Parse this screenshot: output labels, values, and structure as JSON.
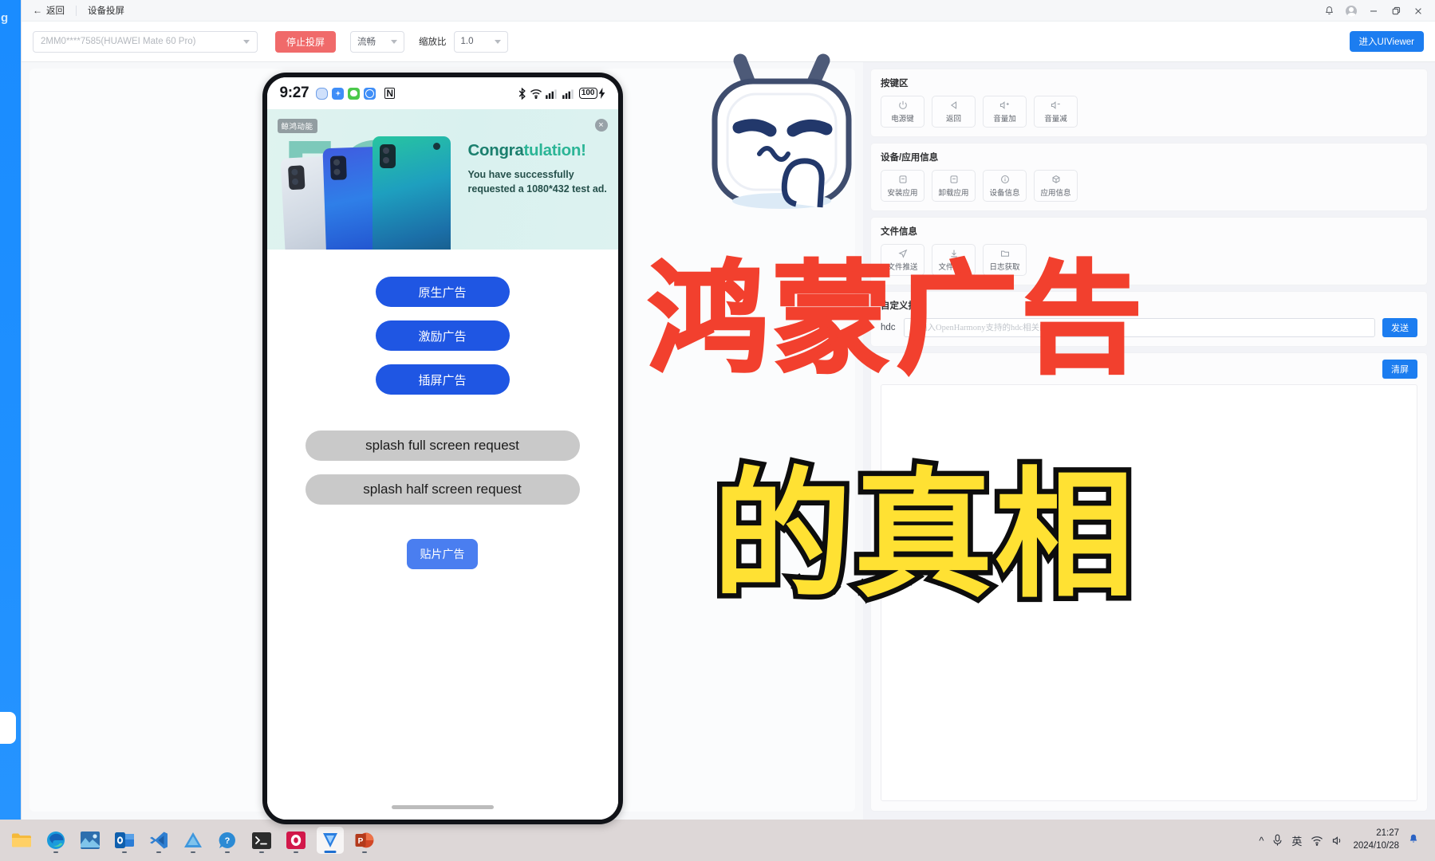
{
  "background_window": {
    "label": "g"
  },
  "titlebar": {
    "back_label": "返回",
    "page_title": "设备投屏",
    "icons": {
      "bell": "bell-icon",
      "avatar": "avatar-icon",
      "minimize": "minimize-icon",
      "restore": "restore-icon",
      "close": "close-icon"
    }
  },
  "toolbar": {
    "device_value": "2MM0****7585(HUAWEI Mate 60 Pro)",
    "stop_label": "停止投屏",
    "quality_value": "流畅",
    "zoom_label": "缩放比",
    "zoom_value": "1.0",
    "uiviewer_label": "进入UIViewer"
  },
  "phone": {
    "status_bar": {
      "time": "9:27",
      "nfc": "N",
      "battery": "100",
      "icons": [
        "app-blue-rounded-icon",
        "app-blue-star-icon",
        "app-wechat-icon",
        "app-compass-icon",
        "nfc-icon",
        "bluetooth-icon",
        "wifi-icon",
        "signal-1-icon",
        "signal-2-icon",
        "battery-icon",
        "charging-icon"
      ]
    },
    "ad": {
      "badge": "鲸鸿动能",
      "close": "×",
      "hero_text": "5G",
      "title_part1": "Congra",
      "title_part2": "tulation!",
      "description": "You have successfully requested a 1080*432 test ad."
    },
    "buttons": [
      {
        "label": "原生广告",
        "style": "blue-pill"
      },
      {
        "label": "激励广告",
        "style": "blue-pill"
      },
      {
        "label": "插屏广告",
        "style": "blue-pill"
      },
      {
        "label": "splash full screen request",
        "style": "grey-pill"
      },
      {
        "label": "splash half screen request",
        "style": "grey-pill"
      },
      {
        "label": "贴片广告",
        "style": "small-blue"
      }
    ]
  },
  "control_panel": {
    "sections": [
      {
        "title": "按键区",
        "buttons": [
          {
            "label": "电源键",
            "icon": "power-icon"
          },
          {
            "label": "返回",
            "icon": "back-triangle-icon"
          },
          {
            "label": "音量加",
            "icon": "volume-up-icon"
          },
          {
            "label": "音量减",
            "icon": "volume-down-icon"
          }
        ]
      },
      {
        "title": "设备/应用信息",
        "buttons": [
          {
            "label": "安装应用",
            "icon": "install-icon"
          },
          {
            "label": "卸载应用",
            "icon": "uninstall-icon"
          },
          {
            "label": "设备信息",
            "icon": "info-circle-icon"
          },
          {
            "label": "应用信息",
            "icon": "cube-icon"
          }
        ]
      },
      {
        "title": "文件信息",
        "buttons": [
          {
            "label": "文件推送",
            "icon": "send-plane-icon"
          },
          {
            "label": "文件获取",
            "icon": "download-icon"
          },
          {
            "label": "日志获取",
            "icon": "folder-icon"
          }
        ]
      }
    ],
    "custom_command": {
      "title": "自定义指令",
      "prefix": "hdc",
      "placeholder": "请输入OpenHarmony支持的hdc相关的命令",
      "input_value": "",
      "send_label": "发送"
    },
    "log": {
      "clear_label": "清屏",
      "content": ""
    }
  },
  "overlays": {
    "mascot": "bilibili-mascot-icon",
    "red_text": "鸿蒙广告",
    "yellow_text": "的真相"
  },
  "taskbar": {
    "apps": [
      {
        "name": "file-explorer",
        "glyph": "",
        "color": "#f7b733",
        "active": false
      },
      {
        "name": "microsoft-edge",
        "glyph": "",
        "color": "#1e8fd6",
        "active": false
      },
      {
        "name": "image-viewer",
        "glyph": "",
        "color": "#2f6fb0",
        "active": false
      },
      {
        "name": "outlook",
        "glyph": "O",
        "color": "#0f6cbd",
        "active": false
      },
      {
        "name": "vs-code",
        "glyph": "",
        "color": "#2f7fd1",
        "active": false
      },
      {
        "name": "deveco-studio",
        "glyph": "",
        "color": "#3a8ed0",
        "active": false
      },
      {
        "name": "help-assistant",
        "glyph": "?",
        "color": "#2b8ad4",
        "active": false
      },
      {
        "name": "terminal",
        "glyph": ">_",
        "color": "#2b2b2b",
        "active": false
      },
      {
        "name": "media-app",
        "glyph": "O",
        "color": "#d81b4a",
        "active": false
      },
      {
        "name": "devtool-v",
        "glyph": "V",
        "color": "#2b7fe0",
        "active": true
      },
      {
        "name": "powerpoint",
        "glyph": "P",
        "color": "#c94b28",
        "active": false
      }
    ],
    "tray": {
      "chevron": "^",
      "mic": "mic-icon",
      "ime": "英",
      "wifi": "wifi-icon",
      "volume": "volume-icon",
      "time": "21:27",
      "date": "2024/10/28",
      "bell": "bell-icon"
    }
  }
}
